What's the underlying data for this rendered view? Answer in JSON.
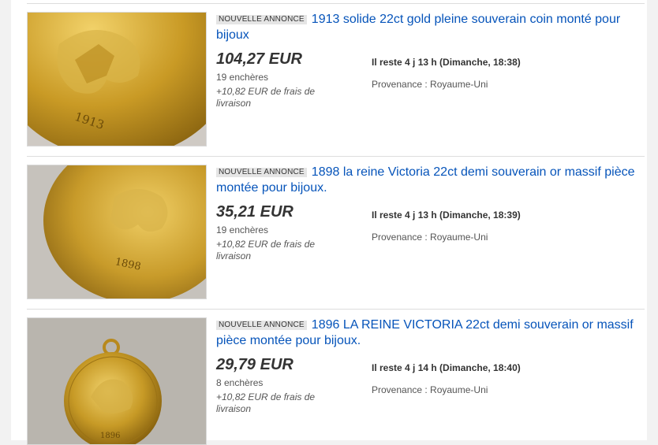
{
  "listings": [
    {
      "badge": "NOUVELLE ANNONCE",
      "title": "1913 solide 22ct gold pleine souverain coin monté pour bijoux",
      "price": "104,27 EUR",
      "bids": "19 enchères",
      "shipping": "+10,82 EUR de frais de livraison",
      "time_left": "Il reste 4 j 13 h (Dimanche, 18:38)",
      "origin": "Provenance : Royaume-Uni",
      "image_year": "1913"
    },
    {
      "badge": "NOUVELLE ANNONCE",
      "title": "1898 la reine Victoria 22ct demi souverain or massif pièce montée pour bijoux.",
      "price": "35,21 EUR",
      "bids": "19 enchères",
      "shipping": "+10,82 EUR de frais de livraison",
      "time_left": "Il reste 4 j 13 h (Dimanche, 18:39)",
      "origin": "Provenance : Royaume-Uni",
      "image_year": "1898"
    },
    {
      "badge": "NOUVELLE ANNONCE",
      "title": "1896 LA REINE VICTORIA 22ct demi souverain or massif pièce montée pour bijoux.",
      "price": "29,79 EUR",
      "bids": "8 enchères",
      "shipping": "+10,82 EUR de frais de livraison",
      "time_left": "Il reste 4 j 14 h (Dimanche, 18:40)",
      "origin": "Provenance : Royaume-Uni",
      "image_year": "1896"
    }
  ],
  "colors": {
    "link": "#0654ba",
    "gold": "#c9a227",
    "text": "#333333"
  }
}
